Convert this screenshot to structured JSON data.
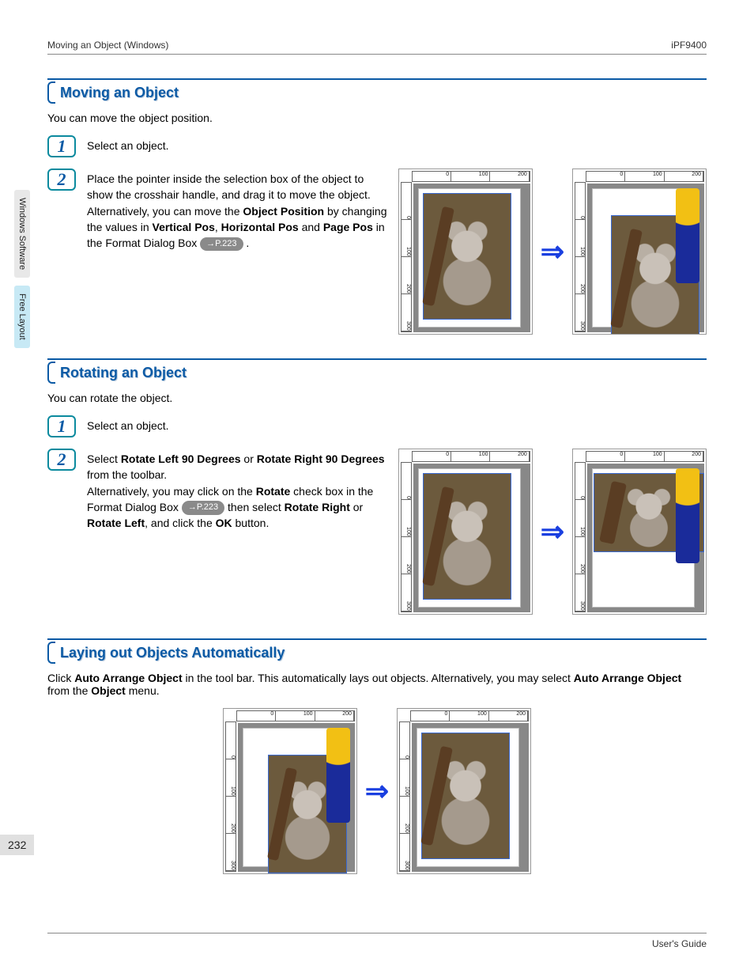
{
  "header": {
    "left": "Moving an Object (Windows)",
    "right": "iPF9400"
  },
  "side_tabs": {
    "inactive": "Windows Software",
    "active": "Free Layout"
  },
  "page_number": "232",
  "footer": "User's Guide",
  "sections": {
    "moving": {
      "title": "Moving an Object",
      "intro": "You can move the object position.",
      "step1": "Select an object.",
      "step2_a": "Place the pointer inside the selection box of the object to show the crosshair handle, and drag it to move the object.",
      "step2_b1": "Alternatively, you can move the ",
      "step2_b2": "Object Position",
      "step2_b3": " by changing the values in ",
      "step2_b4": "Vertical Pos",
      "step2_b5": ", ",
      "step2_b6": "Horizontal Pos",
      "step2_b7": " and ",
      "step2_b8": "Page Pos",
      "step2_b9": " in the Format Dialog Box ",
      "step2_ref": "→P.223",
      "step2_b10": " ."
    },
    "rotating": {
      "title": "Rotating an Object",
      "intro": "You can rotate the object.",
      "step1": "Select an object.",
      "step2_a1": "Select ",
      "step2_a2": "Rotate Left 90 Degrees",
      "step2_a3": " or ",
      "step2_a4": "Rotate Right 90 Degrees",
      "step2_a5": " from the toolbar.",
      "step2_b1": "Alternatively, you may click on the ",
      "step2_b2": "Rotate",
      "step2_b3": " check box in the Format Dialog Box ",
      "step2_ref": "→P.223",
      "step2_b4": "  then select ",
      "step2_b5": "Rotate Right",
      "step2_b6": " or ",
      "step2_b7": "Rotate Left",
      "step2_b8": ", and click the ",
      "step2_b9": "OK",
      "step2_b10": " button."
    },
    "auto": {
      "title": "Laying out Objects Automatically",
      "intro_a": "Click ",
      "intro_b": "Auto Arrange Object",
      "intro_c": " in the tool bar. This automatically lays out objects. Alternatively, you may select ",
      "intro_d": "Auto Arrange Object",
      "intro_e": " from the ",
      "intro_f": "Object",
      "intro_g": " menu."
    }
  },
  "ruler": {
    "t0": "0",
    "t1": "100",
    "t2": "200",
    "t3": "300"
  },
  "arrow": "⇒",
  "step_numbers": {
    "one": "1",
    "two": "2"
  }
}
